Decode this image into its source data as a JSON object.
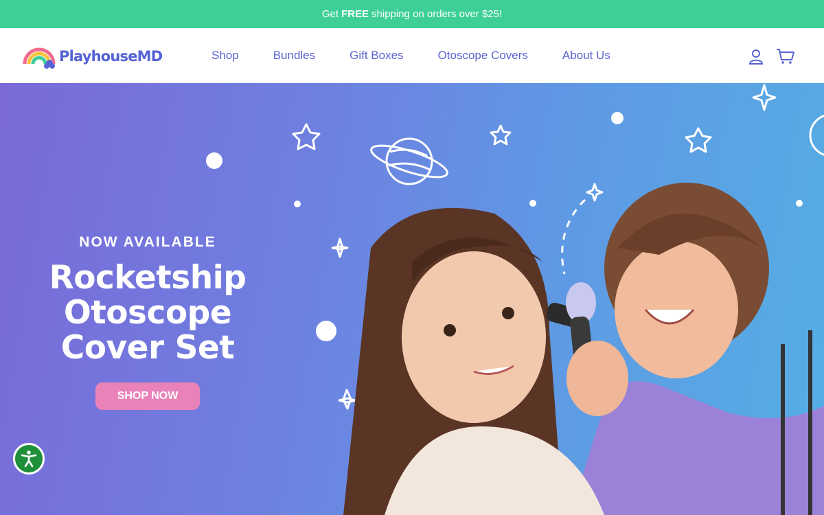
{
  "announcement": {
    "prefix": "Get",
    "bold": "FREE",
    "suffix": "shipping on orders over $25!"
  },
  "header": {
    "logo_text": "PlayhouseMD",
    "nav": [
      "Shop",
      "Bundles",
      "Gift Boxes",
      "Otoscope Covers",
      "About Us"
    ],
    "icons": [
      "account-icon",
      "cart-icon"
    ]
  },
  "hero": {
    "eyebrow": "NOW AVAILABLE",
    "title_lines": [
      "Rocketship",
      "Otoscope",
      "Cover Set"
    ],
    "cta": "SHOP NOW"
  },
  "colors": {
    "announcement_bg": "#3ecf97",
    "nav_text": "#5a64cf",
    "hero_gradient_start": "#7a6ad8",
    "hero_gradient_end": "#55aee4",
    "cta_bg": "#e882b8",
    "accessibility_bg": "#1f8f3a"
  }
}
